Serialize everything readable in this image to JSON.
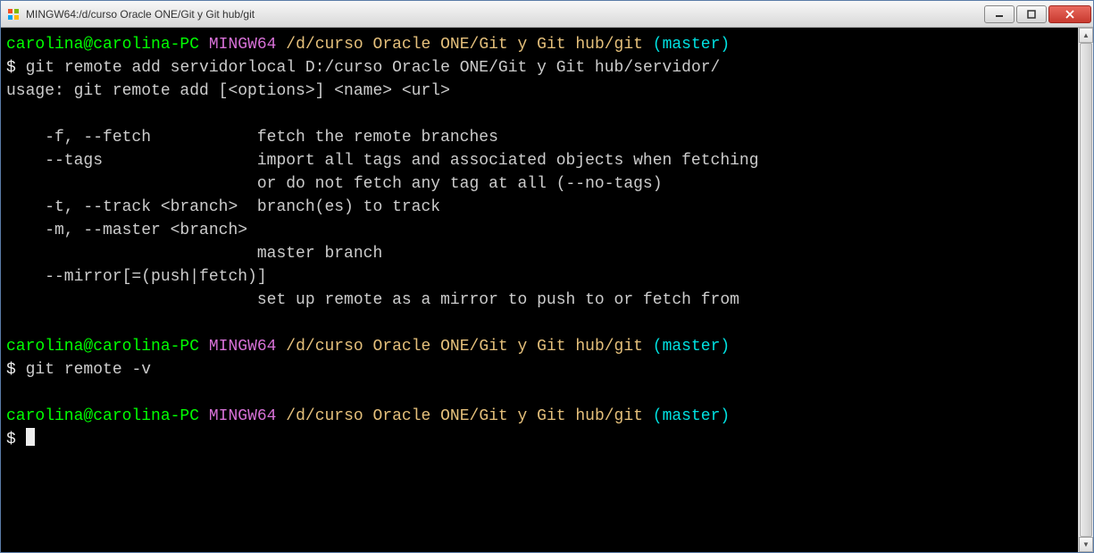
{
  "window": {
    "title": "MINGW64:/d/curso Oracle ONE/Git y Git hub/git"
  },
  "prompt": {
    "user_host": "carolina@carolina-PC",
    "env": "MINGW64",
    "path": "/d/curso Oracle ONE/Git y Git hub/git",
    "branch": "(master)",
    "sigil": "$"
  },
  "commands": {
    "cmd1": "git remote add servidorlocal D:/curso Oracle ONE/Git y Git hub/servidor/",
    "cmd2": "git remote -v"
  },
  "output": {
    "usage": "usage: git remote add [<options>] <name> <url>",
    "blank": " ",
    "opt_f": "    -f, --fetch           fetch the remote branches",
    "opt_tags1": "    --tags                import all tags and associated objects when fetching",
    "opt_tags2": "                          or do not fetch any tag at all (--no-tags)",
    "opt_t": "    -t, --track <branch>  branch(es) to track",
    "opt_m1": "    -m, --master <branch>",
    "opt_m2": "                          master branch",
    "opt_mirror1": "    --mirror[=(push|fetch)]",
    "opt_mirror2": "                          set up remote as a mirror to push to or fetch from"
  }
}
